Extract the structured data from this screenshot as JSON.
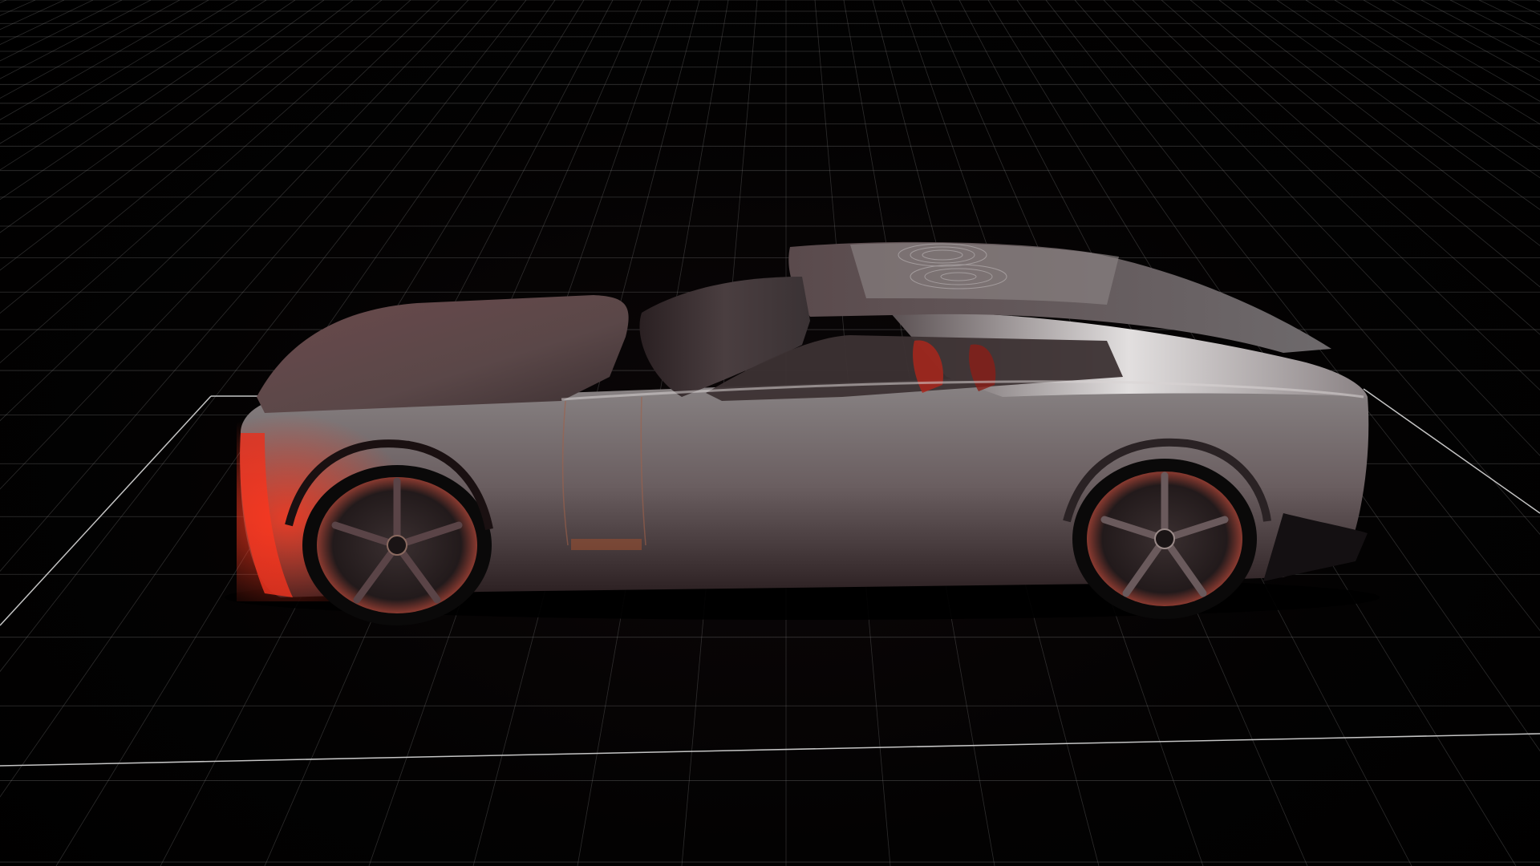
{
  "scene": {
    "background_color": "#000000",
    "grid_color": "#8c8c8c",
    "floor_outline_color": "#d9d9d9",
    "car": {
      "body_color": "#6e6a6c",
      "highlight_color": "#d9d6d6",
      "accent_light_color": "#e0301e",
      "tire_color": "#0a0909",
      "rim_color": "#2a2223"
    }
  }
}
